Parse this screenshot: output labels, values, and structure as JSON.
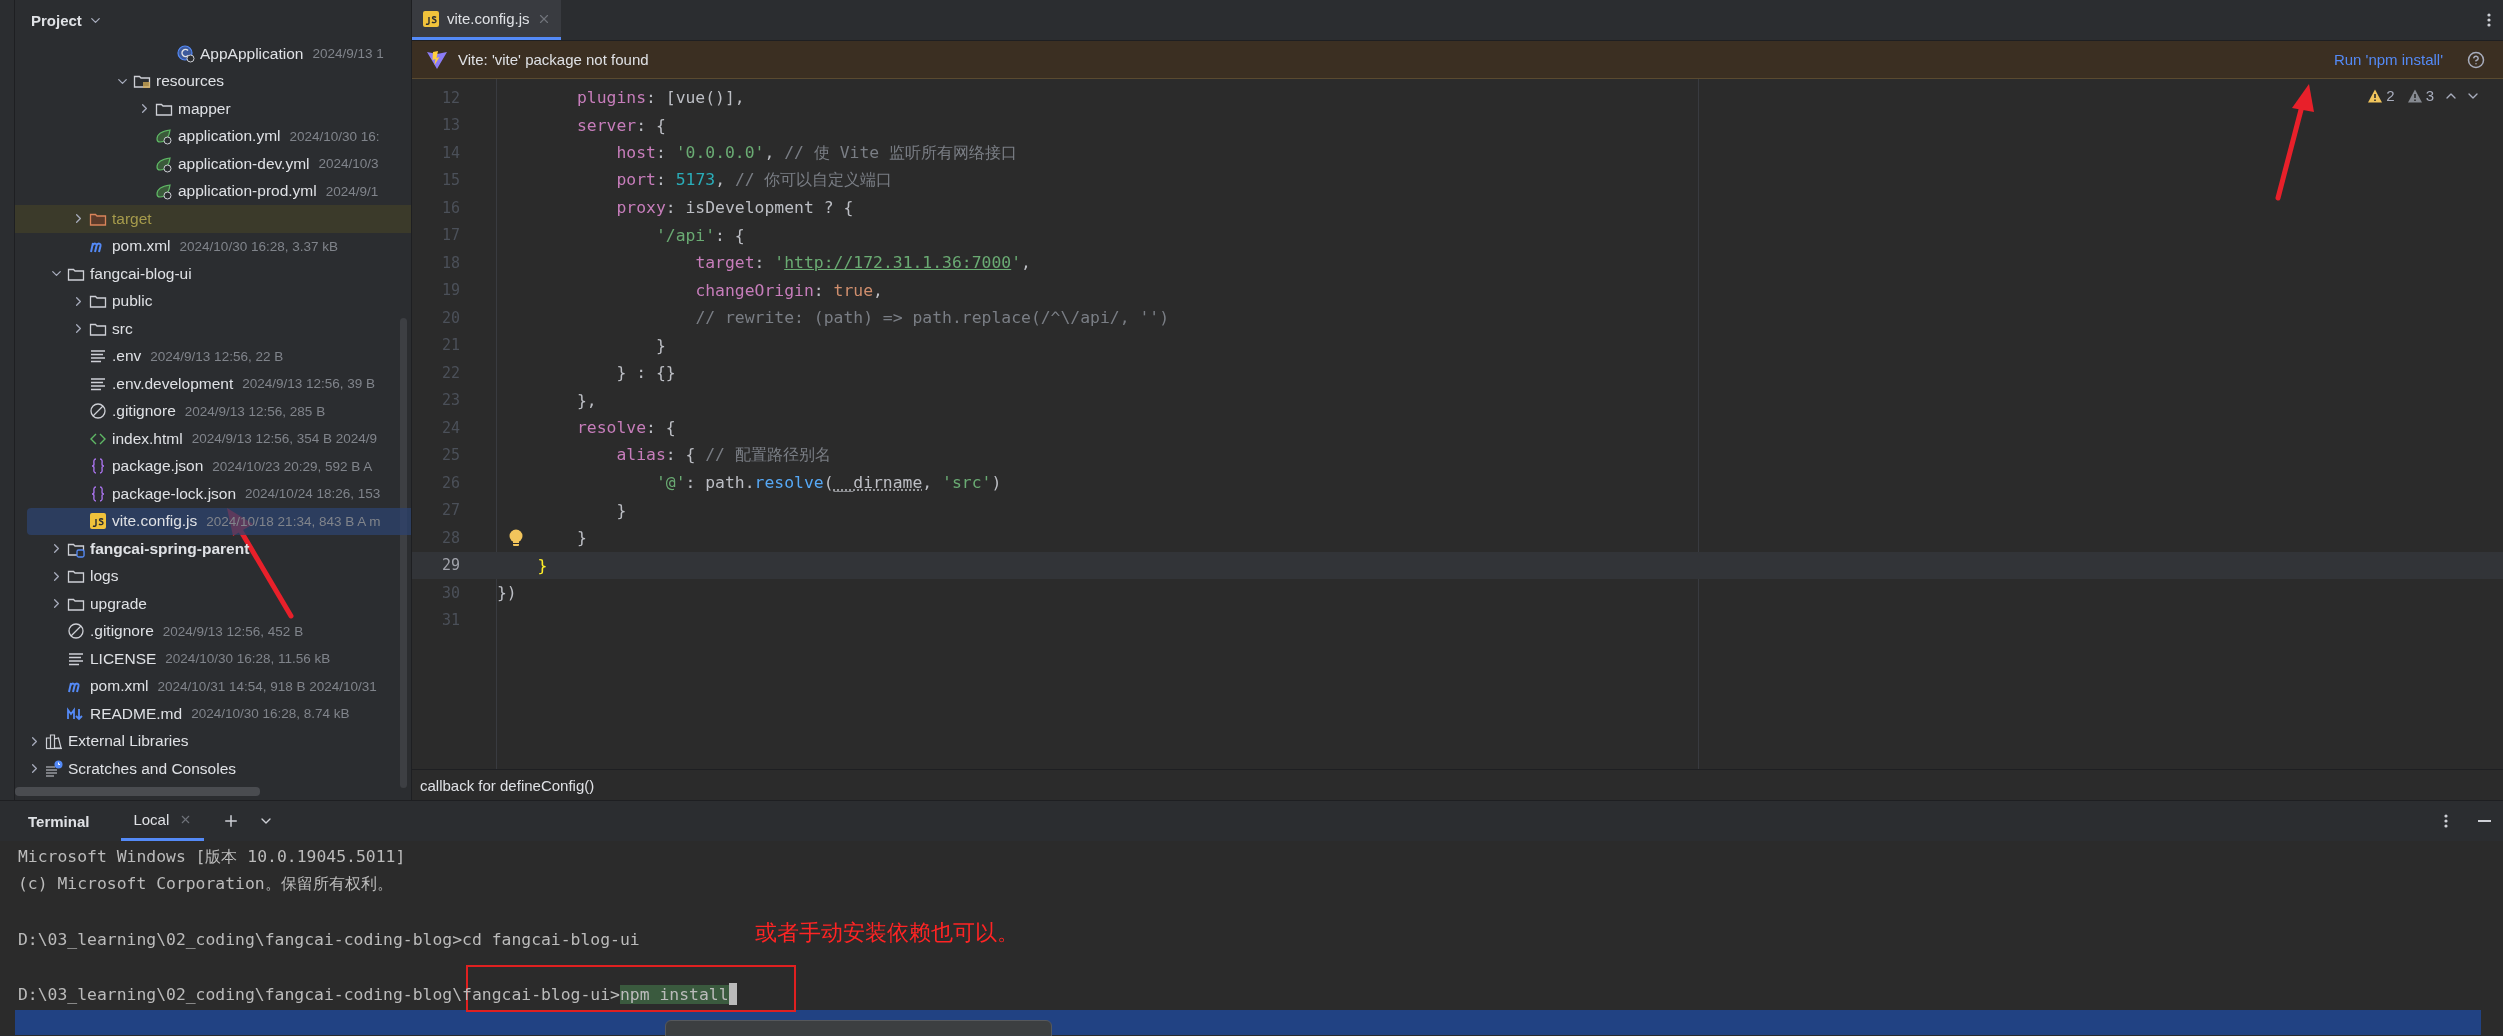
{
  "project_panel": {
    "title": "Project",
    "tree": [
      {
        "children": [
          {
            "children": [
              {
                "children": [
                  {
                    "children": [
                      {
                        "children": [
                          {
                            "children": [
                              {
                                "label": "AppApplication",
                                "meta": "2024/9/13 1",
                                "kind": "class",
                                "selected": false
                              }
                            ]
                          }
                        ]
                      },
                      {
                        "label": "resources",
                        "kind": "resource-folder",
                        "expanded": true,
                        "selected": false,
                        "children": [
                          {
                            "label": "mapper",
                            "kind": "folder",
                            "expanded": false,
                            "selected": false
                          },
                          {
                            "label": "application.yml",
                            "meta": "2024/10/30 16:",
                            "kind": "spring",
                            "selected": false
                          },
                          {
                            "label": "application-dev.yml",
                            "meta": "2024/10/3",
                            "kind": "spring",
                            "selected": false
                          },
                          {
                            "label": "application-prod.yml",
                            "meta": "2024/9/1",
                            "kind": "spring",
                            "selected": false
                          }
                        ]
                      }
                    ]
                  }
                ]
              },
              {
                "label": "target",
                "kind": "excluded-folder",
                "expanded": false,
                "selected": false
              },
              {
                "label": "pom.xml",
                "meta": "2024/10/30 16:28, 3.37 kB",
                "kind": "maven",
                "selected": false
              }
            ]
          },
          {
            "label": "fangcai-blog-ui",
            "kind": "folder",
            "expanded": true,
            "selected": false,
            "children": [
              {
                "label": "public",
                "kind": "folder",
                "expanded": false,
                "selected": false
              },
              {
                "label": "src",
                "kind": "folder",
                "expanded": false,
                "selected": false
              },
              {
                "label": ".env",
                "meta": "2024/9/13 12:56, 22 B",
                "kind": "text",
                "selected": false
              },
              {
                "label": ".env.development",
                "meta": "2024/9/13 12:56, 39 B",
                "kind": "text",
                "selected": false
              },
              {
                "label": ".gitignore",
                "meta": "2024/9/13 12:56, 285 B",
                "kind": "ignore",
                "selected": false
              },
              {
                "label": "index.html",
                "meta": "2024/9/13 12:56, 354 B 2024/9",
                "kind": "html",
                "selected": false
              },
              {
                "label": "package.json",
                "meta": "2024/10/23 20:29, 592 B A",
                "kind": "json",
                "selected": false
              },
              {
                "label": "package-lock.json",
                "meta": "2024/10/24 18:26, 153",
                "kind": "json",
                "selected": false
              },
              {
                "label": "vite.config.js",
                "meta": "2024/10/18 21:34, 843 B A m",
                "kind": "js",
                "selected": true
              }
            ]
          },
          {
            "label": "fangcai-spring-parent",
            "kind": "module-folder",
            "expanded": false,
            "selected": false
          },
          {
            "label": "logs",
            "kind": "folder",
            "expanded": false,
            "selected": false
          },
          {
            "label": "upgrade",
            "kind": "folder",
            "expanded": false,
            "selected": false
          },
          {
            "label": ".gitignore",
            "meta": "2024/9/13 12:56, 452 B",
            "kind": "ignore",
            "selected": false
          },
          {
            "label": "LICENSE",
            "meta": "2024/10/30 16:28, 11.56 kB",
            "kind": "text",
            "selected": false
          },
          {
            "label": "pom.xml",
            "meta": "2024/10/31 14:54, 918 B 2024/10/31",
            "kind": "maven",
            "selected": false
          },
          {
            "label": "README.md",
            "meta": "2024/10/30 16:28, 8.74 kB",
            "kind": "markdown",
            "selected": false
          }
        ]
      },
      {
        "label": "External Libraries",
        "kind": "libraries",
        "expanded": false,
        "selected": false
      },
      {
        "label": "Scratches and Consoles",
        "kind": "scratches",
        "expanded": false,
        "selected": false
      }
    ]
  },
  "editor": {
    "tabs": [
      {
        "label": "vite.config.js",
        "selected": true
      }
    ],
    "banner": {
      "message": "Vite: 'vite' package not found",
      "action": "Run 'npm install'"
    },
    "inspections": [
      {
        "kind": "warning",
        "count": "2"
      },
      {
        "kind": "weak-warning",
        "count": "3"
      }
    ],
    "lines": [
      {
        "number": "12",
        "kind": "plain",
        "current": false,
        "tokens": [
          {
            "text": "        plugins",
            "kind": "property"
          },
          {
            "text": ": [vue()],"
          }
        ]
      },
      {
        "number": "13",
        "kind": "plain",
        "current": false,
        "tokens": [
          {
            "text": "        server",
            "kind": "property"
          },
          {
            "text": ": {"
          }
        ]
      },
      {
        "number": "14",
        "kind": "plain",
        "current": false,
        "tokens": [
          {
            "text": "            host",
            "kind": "property"
          },
          {
            "text": ": "
          },
          {
            "text": "'0.0.0.0'",
            "kind": "string"
          },
          {
            "text": ", "
          },
          {
            "text": "// 使 Vite 监听所有网络接口",
            "kind": "comment"
          }
        ]
      },
      {
        "number": "15",
        "kind": "plain",
        "current": false,
        "tokens": [
          {
            "text": "            port",
            "kind": "property"
          },
          {
            "text": ": "
          },
          {
            "text": "5173",
            "kind": "number"
          },
          {
            "text": ", "
          },
          {
            "text": "// 你可以自定义端口",
            "kind": "comment"
          }
        ]
      },
      {
        "number": "16",
        "kind": "plain",
        "current": false,
        "tokens": [
          {
            "text": "            proxy",
            "kind": "property"
          },
          {
            "text": ": isDevelopment ? {"
          }
        ]
      },
      {
        "number": "17",
        "kind": "plain",
        "current": false,
        "tokens": [
          {
            "text": "                '/api'",
            "kind": "string"
          },
          {
            "text": ": {"
          }
        ]
      },
      {
        "number": "18",
        "kind": "plain",
        "current": false,
        "tokens": [
          {
            "text": "                    target",
            "kind": "property"
          },
          {
            "text": ": "
          },
          {
            "text": "'",
            "kind": "string"
          },
          {
            "text": "http://172.31.1.36:7000",
            "kind": "link"
          },
          {
            "text": "'",
            "kind": "string"
          },
          {
            "text": ","
          }
        ]
      },
      {
        "number": "19",
        "kind": "plain",
        "current": false,
        "tokens": [
          {
            "text": "                    changeOrigin",
            "kind": "property"
          },
          {
            "text": ": "
          },
          {
            "text": "true",
            "kind": "keyword"
          },
          {
            "text": ","
          }
        ]
      },
      {
        "number": "20",
        "kind": "plain",
        "current": false,
        "tokens": [
          {
            "text": "                    // rewrite: (path) => path.replace(/^\\/api/, '')",
            "kind": "comment"
          }
        ]
      },
      {
        "number": "21",
        "kind": "plain",
        "current": false,
        "tokens": [
          {
            "text": "                }"
          }
        ]
      },
      {
        "number": "22",
        "kind": "plain",
        "current": false,
        "tokens": [
          {
            "text": "            } : {}"
          }
        ]
      },
      {
        "number": "23",
        "kind": "plain",
        "current": false,
        "tokens": [
          {
            "text": "        },"
          }
        ]
      },
      {
        "number": "24",
        "kind": "plain",
        "current": false,
        "tokens": [
          {
            "text": "        resolve",
            "kind": "property"
          },
          {
            "text": ": {"
          }
        ]
      },
      {
        "number": "25",
        "kind": "plain",
        "current": false,
        "tokens": [
          {
            "text": "            alias",
            "kind": "property"
          },
          {
            "text": ": { "
          },
          {
            "text": "// 配置路径别名",
            "kind": "comment"
          }
        ]
      },
      {
        "number": "26",
        "kind": "plain",
        "current": false,
        "tokens": [
          {
            "text": "                '@'",
            "kind": "string"
          },
          {
            "text": ": path."
          },
          {
            "text": "resolve",
            "kind": "method"
          },
          {
            "text": "("
          },
          {
            "text": "__dirname",
            "kind": "global"
          },
          {
            "text": ", "
          },
          {
            "text": "'src'",
            "kind": "string"
          },
          {
            "text": ")"
          }
        ]
      },
      {
        "number": "27",
        "kind": "plain",
        "current": false,
        "tokens": [
          {
            "text": "            }"
          }
        ]
      },
      {
        "number": "28",
        "kind": "bulb",
        "current": false,
        "tokens": [
          {
            "text": "        }"
          }
        ]
      },
      {
        "number": "29",
        "kind": "plain",
        "current": true,
        "tokens": [
          {
            "text": "    }",
            "kind": "brace"
          }
        ]
      },
      {
        "number": "30",
        "kind": "plain",
        "current": false,
        "tokens": [
          {
            "text": "})"
          }
        ]
      },
      {
        "number": "31",
        "kind": "plain",
        "current": false
      }
    ],
    "breadcrumb": "callback for defineConfig()"
  },
  "terminal": {
    "title": "Terminal",
    "tabs": [
      {
        "label": "Local",
        "selected": true
      }
    ],
    "lines": [
      {
        "kind": "output",
        "text": "Microsoft Windows [版本 10.0.19045.5011]"
      },
      {
        "kind": "output",
        "text": "(c) Microsoft Corporation。保留所有权利。"
      },
      {
        "kind": "blank"
      },
      {
        "kind": "command",
        "prompt": "D:\\03_learning\\02_coding\\fangcai-coding-blog>",
        "command": "cd fangcai-blog-ui",
        "active": false
      },
      {
        "kind": "blank"
      },
      {
        "kind": "command",
        "prompt": "D:\\03_learning\\02_coding\\fangcai-coding-blog\\fangcai-blog-ui>",
        "command": "npm install",
        "active": true
      }
    ]
  },
  "annotations": {
    "note": "或者手动安装依赖也可以。"
  }
}
